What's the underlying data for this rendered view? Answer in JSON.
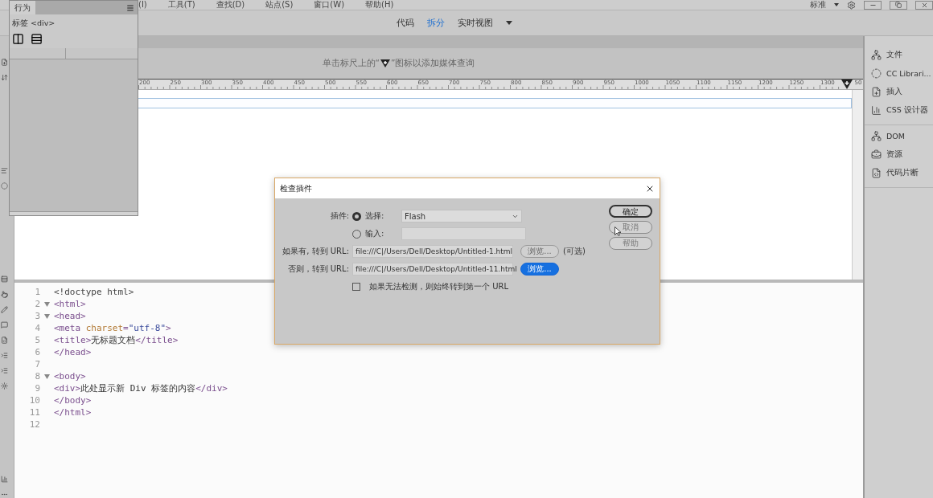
{
  "menu_bar": {
    "items": [
      "(I)",
      "工具(T)",
      "查找(D)",
      "站点(S)",
      "窗口(W)",
      "帮助(H)"
    ],
    "workspace": "标准"
  },
  "view_switcher": [
    {
      "label": "代码",
      "selected": false
    },
    {
      "label": "拆分",
      "selected": true
    },
    {
      "label": "实时视图",
      "selected": false
    }
  ],
  "behaviors_panel": {
    "title": "行为",
    "tag_label": "标签 <div>"
  },
  "media_query_hint": {
    "before": "单击标尺上的“",
    "after": "”图标以添加媒体查询"
  },
  "ruler": {
    "labels": [
      "200",
      "250",
      "300",
      "350",
      "400",
      "450",
      "500",
      "550",
      "600",
      "650",
      "700",
      "750",
      "800",
      "850",
      "900",
      "950",
      "1000",
      "1050",
      "1100",
      "1150",
      "1200",
      "1250",
      "1300",
      "50"
    ]
  },
  "code_lines": [
    {
      "number": "1",
      "fold": false,
      "tokens": [
        {
          "kind": "plain",
          "text": "<!doctype html>"
        }
      ]
    },
    {
      "number": "2",
      "fold": true,
      "tokens": [
        {
          "kind": "tag",
          "text": "<html>"
        }
      ]
    },
    {
      "number": "3",
      "fold": true,
      "tokens": [
        {
          "kind": "tag",
          "text": "<head>"
        }
      ]
    },
    {
      "number": "4",
      "fold": false,
      "tokens": [
        {
          "kind": "tag",
          "text": "<meta "
        },
        {
          "kind": "attr",
          "text": "charset"
        },
        {
          "kind": "tag",
          "text": "="
        },
        {
          "kind": "string",
          "text": "\"utf-8\""
        },
        {
          "kind": "tag",
          "text": ">"
        }
      ]
    },
    {
      "number": "5",
      "fold": false,
      "tokens": [
        {
          "kind": "tag",
          "text": "<title>"
        },
        {
          "kind": "text",
          "text": "无标题文档"
        },
        {
          "kind": "tag",
          "text": "</title>"
        }
      ]
    },
    {
      "number": "6",
      "fold": false,
      "tokens": [
        {
          "kind": "tag",
          "text": "</head>"
        }
      ]
    },
    {
      "number": "7",
      "fold": false
    },
    {
      "number": "8",
      "fold": true,
      "tokens": [
        {
          "kind": "tag",
          "text": "<body>"
        }
      ]
    },
    {
      "number": "9",
      "fold": false,
      "tokens": [
        {
          "kind": "tag",
          "text": "<div>"
        },
        {
          "kind": "text",
          "text": "此处显示新 Div 标签的内容"
        },
        {
          "kind": "tag",
          "text": "</div>"
        }
      ]
    },
    {
      "number": "10",
      "fold": false,
      "tokens": [
        {
          "kind": "tag",
          "text": "</body>"
        }
      ]
    },
    {
      "number": "11",
      "fold": false,
      "tokens": [
        {
          "kind": "tag",
          "text": "</html>"
        }
      ]
    },
    {
      "number": "12",
      "fold": false
    }
  ],
  "right_panel": {
    "groups": [
      [
        {
          "kind": "files",
          "label": "文件"
        },
        {
          "kind": "cc",
          "label": "CC Librari..."
        },
        {
          "kind": "insert",
          "label": "插入"
        },
        {
          "kind": "css",
          "label": "CSS 设计器"
        }
      ],
      [
        {
          "kind": "dom",
          "label": "DOM"
        },
        {
          "kind": "assets",
          "label": "资源"
        },
        {
          "kind": "snippets",
          "label": "代码片断"
        }
      ]
    ]
  },
  "dialog": {
    "title": "检查插件",
    "plugin_label": "插件:",
    "plugin_options": [
      {
        "label": "选择:",
        "selected": true,
        "value": "Flash"
      },
      {
        "label": "输入:",
        "selected": false
      }
    ],
    "url_rows": [
      {
        "label": "如果有, 转到 URL:",
        "value": "file:///C|/Users/Dell/Desktop/Untitled-1.html",
        "browse": "浏览...",
        "focused": false,
        "note": "(可选)"
      },
      {
        "label": "否则，转到 URL:",
        "value": "file:///C|/Users/Dell/Desktop/Untitled-11.html",
        "browse": "浏览...",
        "focused": true
      }
    ],
    "always_redirect": {
      "label": "如果无法检测，则始终转到第一个 URL",
      "checked": false
    },
    "buttons": [
      {
        "label": "确定",
        "default": true
      },
      {
        "label": "取消",
        "default": false
      },
      {
        "label": "帮助",
        "default": false
      }
    ]
  }
}
